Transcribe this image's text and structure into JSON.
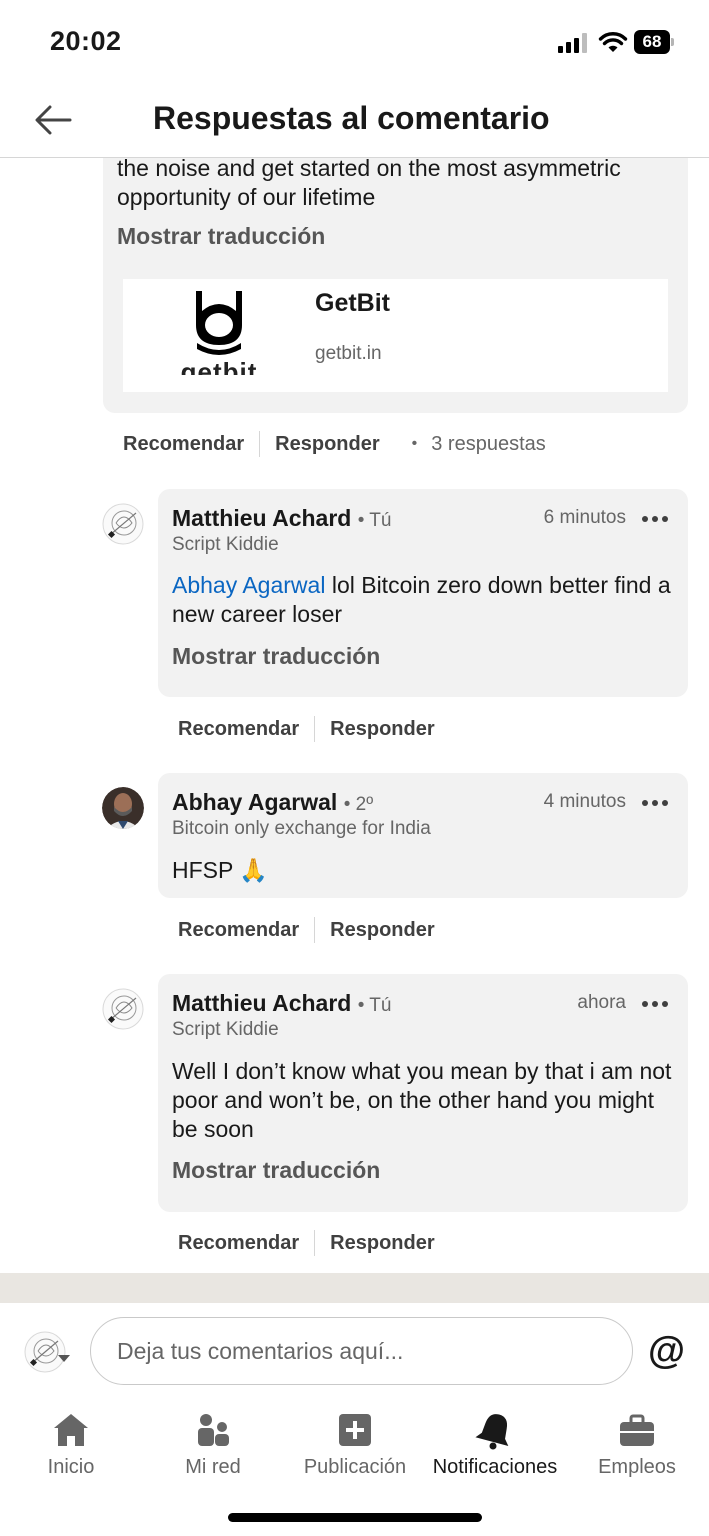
{
  "status_bar": {
    "time": "20:02",
    "battery": "68"
  },
  "header": {
    "title": "Respuestas al comentario"
  },
  "parent_comment": {
    "text_tail": "the noise and get started on the most asymmetric opportunity of our lifetime",
    "show_translation": "Mostrar traducción",
    "link_card": {
      "logo_text": "getbit",
      "title": "GetBit",
      "domain": "getbit.in"
    },
    "actions": {
      "like": "Recomendar",
      "reply": "Responder",
      "dot": "•",
      "replies_count": "3 respuestas"
    }
  },
  "replies": [
    {
      "author": "Matthieu Achard",
      "degree": "• Tú",
      "headline": "Script Kiddie",
      "time": "6 minutos",
      "mention": "Abhay Agarwal",
      "text": " lol Bitcoin zero down better find a new career loser",
      "show_translation": "Mostrar traducción",
      "actions": {
        "like": "Recomendar",
        "reply": "Responder"
      }
    },
    {
      "author": "Abhay Agarwal",
      "degree": "• 2º",
      "headline": "Bitcoin only exchange for India",
      "time": "4 minutos",
      "text": "HFSP 🙏",
      "actions": {
        "like": "Recomendar",
        "reply": "Responder"
      }
    },
    {
      "author": "Matthieu Achard",
      "degree": "• Tú",
      "headline": "Script Kiddie",
      "time": "ahora",
      "text": "Well I don’t know what you mean by that i am not poor and won’t be, on the other hand you might be soon",
      "show_translation": "Mostrar traducción",
      "actions": {
        "like": "Recomendar",
        "reply": "Responder"
      }
    }
  ],
  "composer": {
    "placeholder": "Deja tus comentarios aquí...",
    "mention_button": "@"
  },
  "bottom_nav": {
    "items": [
      {
        "label": "Inicio",
        "icon": "home-icon"
      },
      {
        "label": "Mi red",
        "icon": "network-icon"
      },
      {
        "label": "Publicación",
        "icon": "post-icon"
      },
      {
        "label": "Notificaciones",
        "icon": "bell-icon",
        "active": true
      },
      {
        "label": "Empleos",
        "icon": "briefcase-icon"
      }
    ]
  },
  "colors": {
    "accent_link": "#0a66c2",
    "bubble_bg": "#f2f2f2",
    "text_primary": "#191919",
    "text_secondary": "#666666"
  }
}
